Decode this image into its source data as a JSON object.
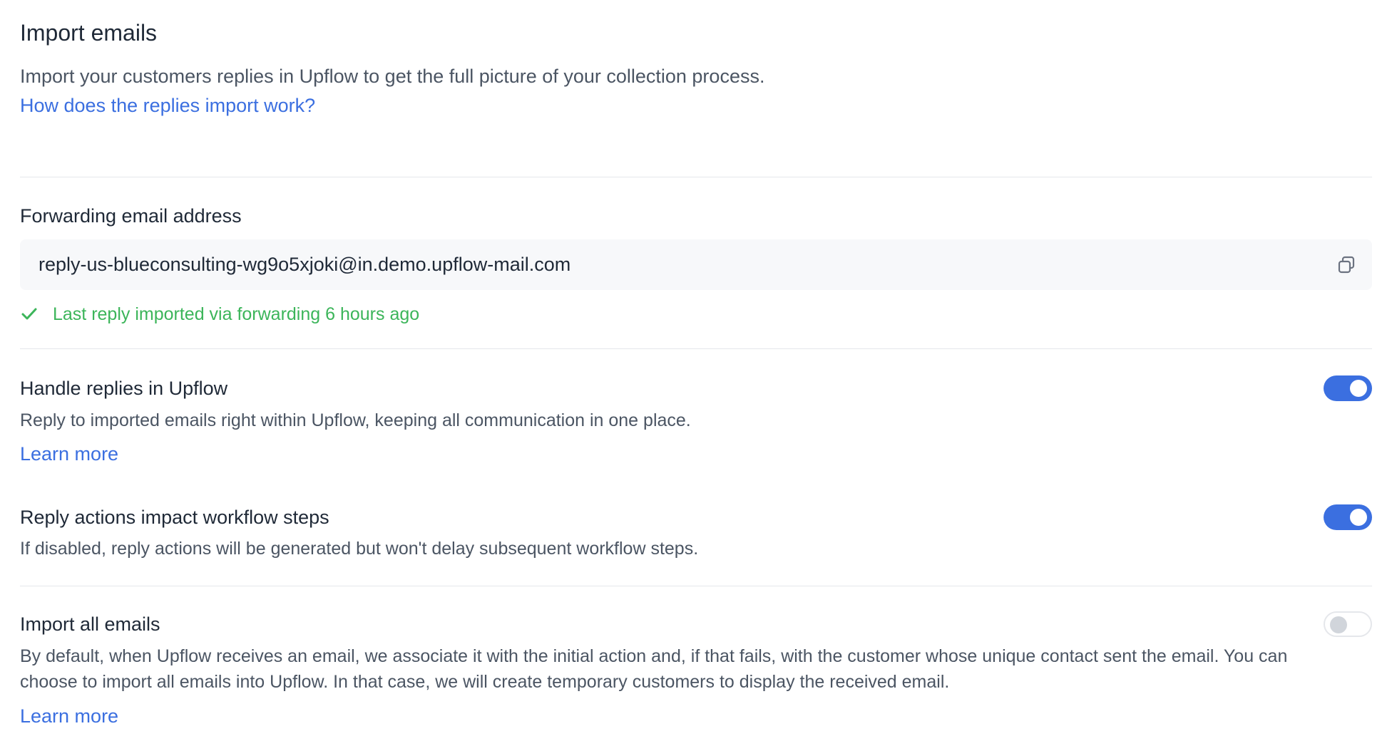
{
  "header": {
    "title": "Import emails",
    "description": "Import your customers replies in Upflow to get the full picture of your collection process.",
    "help_link": "How does the replies import work?"
  },
  "forwarding": {
    "label": "Forwarding email address",
    "email": "reply-us-blueconsulting-wg9o5xjoki@in.demo.upflow-mail.com",
    "copy_icon": "copy-icon",
    "status": "Last reply imported via forwarding 6 hours ago",
    "status_icon": "check-icon",
    "status_color": "#3cb55a"
  },
  "settings": {
    "handle_replies": {
      "title": "Handle replies in Upflow",
      "description": "Reply to imported emails right within Upflow, keeping all communication in one place.",
      "link": "Learn more",
      "enabled": true
    },
    "reply_actions": {
      "title": "Reply actions impact workflow steps",
      "description": "If disabled, reply actions will be generated but won't delay subsequent workflow steps.",
      "enabled": true
    },
    "import_all": {
      "title": "Import all emails",
      "description": "By default, when Upflow receives an email, we associate it with the initial action and, if that fails, with the customer whose unique contact sent the email. You can choose to import all emails into Upflow. In that case, we will create temporary customers to display the received email.",
      "link": "Learn more",
      "enabled": false
    }
  },
  "colors": {
    "accent": "#3b6fe0",
    "success": "#3cb55a",
    "toggle_off_knob": "#d1d5db"
  }
}
